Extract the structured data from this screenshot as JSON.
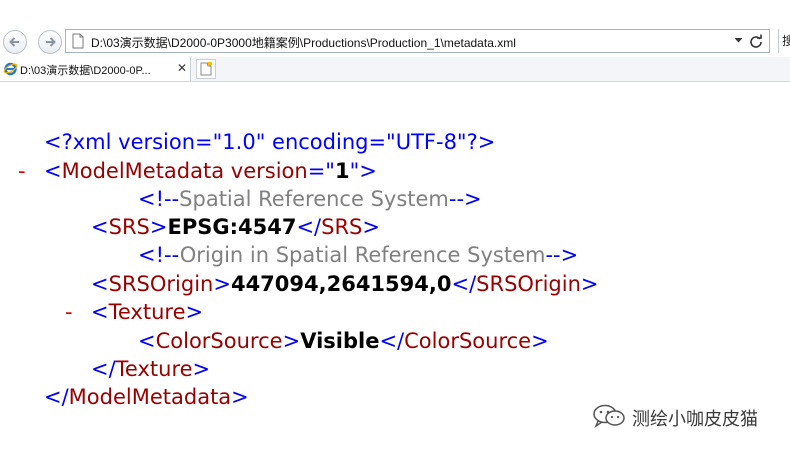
{
  "browser": {
    "address_url": "D:\\03演示数据\\D2000-0P3000地籍案例\\Productions\\Production_1\\metadata.xml",
    "tab_title": "D:\\03演示数据\\D2000-0P...",
    "tab_close": "✕",
    "side_button_label": "搜",
    "icons": {
      "back": "back-arrow-icon",
      "forward": "forward-arrow-icon",
      "page": "page-icon",
      "dropdown": "chevron-down-icon",
      "refresh": "refresh-icon",
      "ie": "ie-icon",
      "new_tab": "new-tab-icon"
    }
  },
  "xml": {
    "collapse_marker": "-",
    "declaration": "<?xml version=\"1.0\" encoding=\"UTF-8\"?>",
    "root_open_tag": "<ModelMetadata",
    "root_attr_name": " version",
    "root_attr_eq": "=\"",
    "root_attr_value": "1",
    "root_attr_close": "\">",
    "comment_open": "<!--",
    "comment_close": "-->",
    "srs_comment": "Spatial Reference System",
    "srs_open_lt": "<",
    "srs_tag": "SRS",
    "srs_open_gt": ">",
    "srs_value": "EPSG:4547",
    "srs_close_lt": "</",
    "srs_close_gt": ">",
    "origin_comment": "Origin in Spatial Reference System",
    "origin_tag": "SRSOrigin",
    "origin_value": "447094,2641594,0",
    "texture_tag": "Texture",
    "colorsource_tag": "ColorSource",
    "colorsource_value": "Visible",
    "root_close_lt": "</",
    "root_tag": "ModelMetadata",
    "root_close_gt": ">"
  },
  "watermark": {
    "text": "测绘小咖皮皮猫",
    "icon": "wechat-icon"
  },
  "colors": {
    "markup_blue": "#0000ff",
    "tag_red": "#990000",
    "comment_gray": "#808080",
    "collapse_red": "#e00000"
  }
}
